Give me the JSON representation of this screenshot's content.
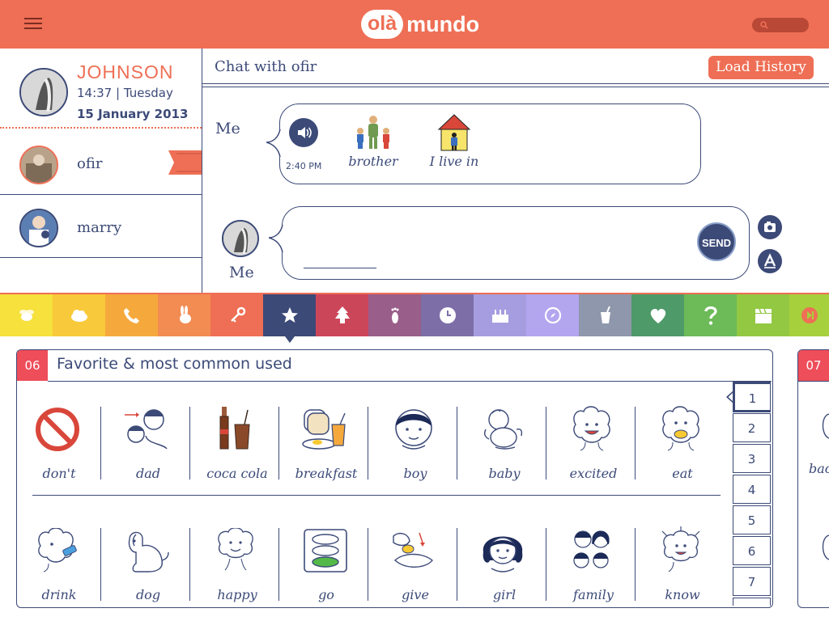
{
  "header": {
    "logo_ola": "olà",
    "logo_mundo": "mundo"
  },
  "profile": {
    "name": "JOHNSON",
    "time_line": "14:37 | Tuesday",
    "date_line": "15 January 2013"
  },
  "contacts": [
    {
      "name": "ofir"
    },
    {
      "name": "marry"
    }
  ],
  "chat": {
    "title": "Chat with ofir",
    "load_history": "Load History",
    "message": {
      "sender": "Me",
      "time": "2:40 PM",
      "symbols": [
        "brother",
        "I live in"
      ]
    },
    "compose": {
      "sender": "Me",
      "send_label": "SEND"
    }
  },
  "categories": [
    {
      "icon": "bee-icon",
      "color": "#f6e13d"
    },
    {
      "icon": "cloud-icon",
      "color": "#f8c93a"
    },
    {
      "icon": "phone-icon",
      "color": "#f5a93d"
    },
    {
      "icon": "rabbit-icon",
      "color": "#f28c52"
    },
    {
      "icon": "key-icon",
      "color": "#ee6f55"
    },
    {
      "icon": "star-icon",
      "color": "#3c4a78",
      "selected": true
    },
    {
      "icon": "tree-icon",
      "color": "#cc4659"
    },
    {
      "icon": "footprint-icon",
      "color": "#9a5e8a"
    },
    {
      "icon": "clock-icon",
      "color": "#7e6ea8"
    },
    {
      "icon": "cake-icon",
      "color": "#a59ddf"
    },
    {
      "icon": "compass-icon",
      "color": "#b3a6ef"
    },
    {
      "icon": "drink-icon",
      "color": "#8e97ab"
    },
    {
      "icon": "heart-icon",
      "color": "#4e9a69"
    },
    {
      "icon": "question-icon",
      "color": "#6cba58"
    },
    {
      "icon": "clapper-icon",
      "color": "#93c843"
    },
    {
      "icon": "next-icon",
      "color": "#a7d03d"
    }
  ],
  "board": {
    "number": "06",
    "title": "Favorite & most common used",
    "row1": [
      "don't",
      "dad",
      "coca cola",
      "breakfast",
      "boy",
      "baby",
      "excited",
      "eat"
    ],
    "row2": [
      "drink",
      "dog",
      "happy",
      "go",
      "give",
      "girl",
      "family",
      "know"
    ],
    "pages": [
      "1",
      "2",
      "3",
      "4",
      "5",
      "6",
      "7"
    ]
  },
  "next_board": {
    "number": "07",
    "peek_labels": [
      "bac"
    ]
  }
}
